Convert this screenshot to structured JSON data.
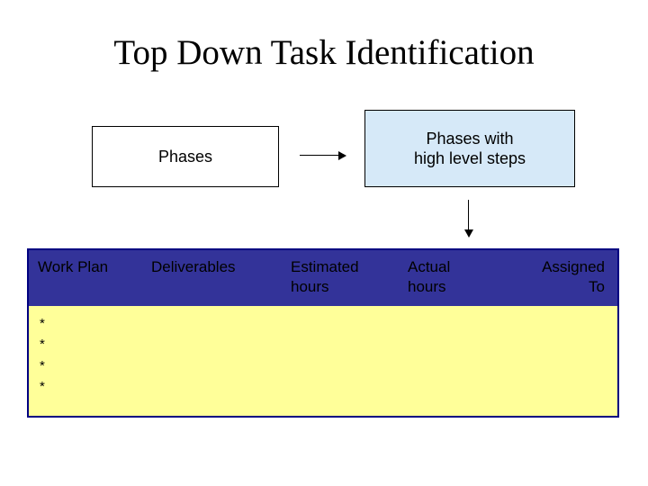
{
  "title": "Top Down Task Identification",
  "boxes": {
    "phases_label": "Phases",
    "phases_hl_line1": "Phases with",
    "phases_hl_line2": "high level steps"
  },
  "table": {
    "headers": {
      "workplan": "Work Plan",
      "deliverables": "Deliverables",
      "estimated_line1": "Estimated",
      "estimated_line2": "hours",
      "actual_line1": "Actual",
      "actual_line2": "hours",
      "assigned_line1": "Assigned",
      "assigned_line2": "To"
    },
    "bullets": [
      "*",
      "*",
      "*",
      "*"
    ]
  }
}
